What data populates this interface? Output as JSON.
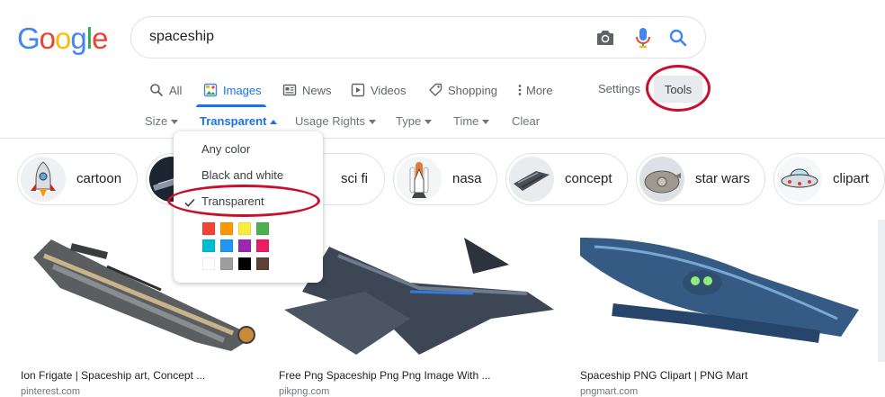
{
  "logo": {
    "letters": [
      "G",
      "o",
      "o",
      "g",
      "l",
      "e"
    ],
    "colors": [
      "#4285F4",
      "#EA4335",
      "#FBBC05",
      "#4285F4",
      "#34A853",
      "#EA4335"
    ]
  },
  "search": {
    "query": "spaceship",
    "icons": [
      "camera-icon",
      "microphone-icon",
      "search-icon"
    ]
  },
  "tabs": [
    {
      "label": "All",
      "icon": "search-icon"
    },
    {
      "label": "Images",
      "icon": "image-icon",
      "active": true
    },
    {
      "label": "News",
      "icon": "newspaper-icon"
    },
    {
      "label": "Videos",
      "icon": "play-icon"
    },
    {
      "label": "Shopping",
      "icon": "tag-icon"
    },
    {
      "label": "More",
      "icon": "more-vertical-icon"
    }
  ],
  "settings_label": "Settings",
  "tools_label": "Tools",
  "filters": [
    {
      "label": "Size"
    },
    {
      "label": "Transparent",
      "selected": true
    },
    {
      "label": "Usage Rights"
    },
    {
      "label": "Type"
    },
    {
      "label": "Time"
    },
    {
      "label": "Clear"
    }
  ],
  "color_menu": {
    "options": [
      "Any color",
      "Black and white",
      "Transparent"
    ],
    "selected": "Transparent",
    "swatches": [
      "#f44336",
      "#ff9800",
      "#ffeb3b",
      "#4caf50",
      "#00bcd4",
      "#2196f3",
      "#9c27b0",
      "#e91e63",
      "#ffffff",
      "#9e9e9e",
      "#000000",
      "#5d4037"
    ]
  },
  "chips": [
    {
      "label": "cartoon"
    },
    {
      "label": ""
    },
    {
      "label": "sci fi"
    },
    {
      "label": "nasa"
    },
    {
      "label": "concept"
    },
    {
      "label": "star wars"
    },
    {
      "label": "clipart"
    }
  ],
  "results": [
    {
      "title": "Ion Frigate | Spaceship art, Concept ...",
      "domain": "pinterest.com"
    },
    {
      "title": "Free Png Spaceship Png Png Image With ...",
      "domain": "pikpng.com"
    },
    {
      "title": "Spaceship PNG Clipart | PNG Mart",
      "domain": "pngmart.com"
    }
  ],
  "colors": {
    "accent": "#1a73e8",
    "highlight_ring": "#c8102e"
  }
}
